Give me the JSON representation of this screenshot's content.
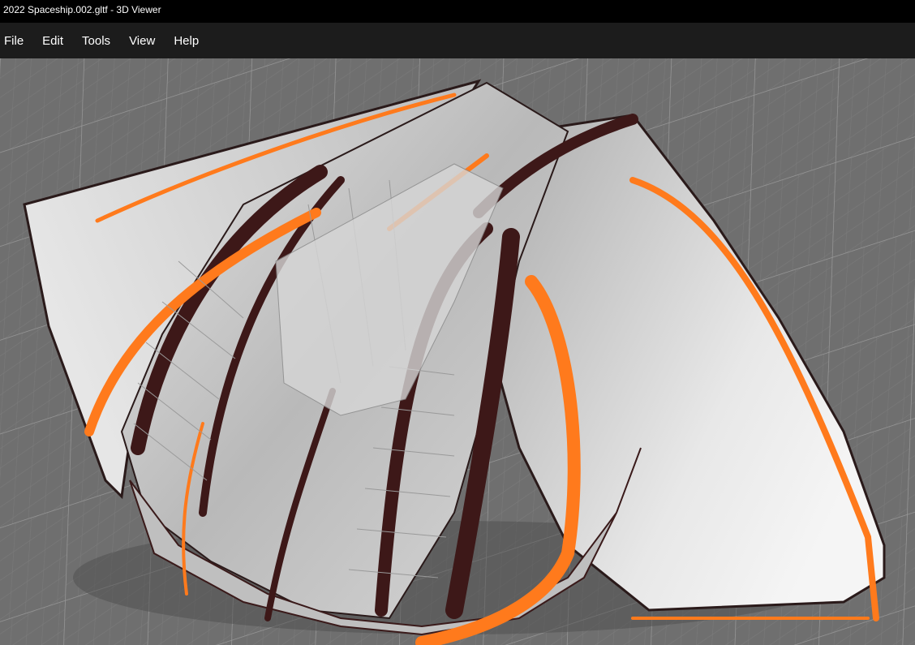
{
  "window": {
    "title": "2022 Spaceship.002.gltf - 3D Viewer"
  },
  "menu": {
    "items": [
      {
        "label": "File"
      },
      {
        "label": "Edit"
      },
      {
        "label": "Tools"
      },
      {
        "label": "View"
      },
      {
        "label": "Help"
      }
    ]
  },
  "viewport": {
    "model": "spaceship",
    "colors": {
      "ground": "#6e6e6e",
      "grid": "#8a8a8a",
      "hull": "#c8c8c8",
      "accent": "#ff7a1c",
      "dark_stripe": "#3a1a1a"
    }
  }
}
